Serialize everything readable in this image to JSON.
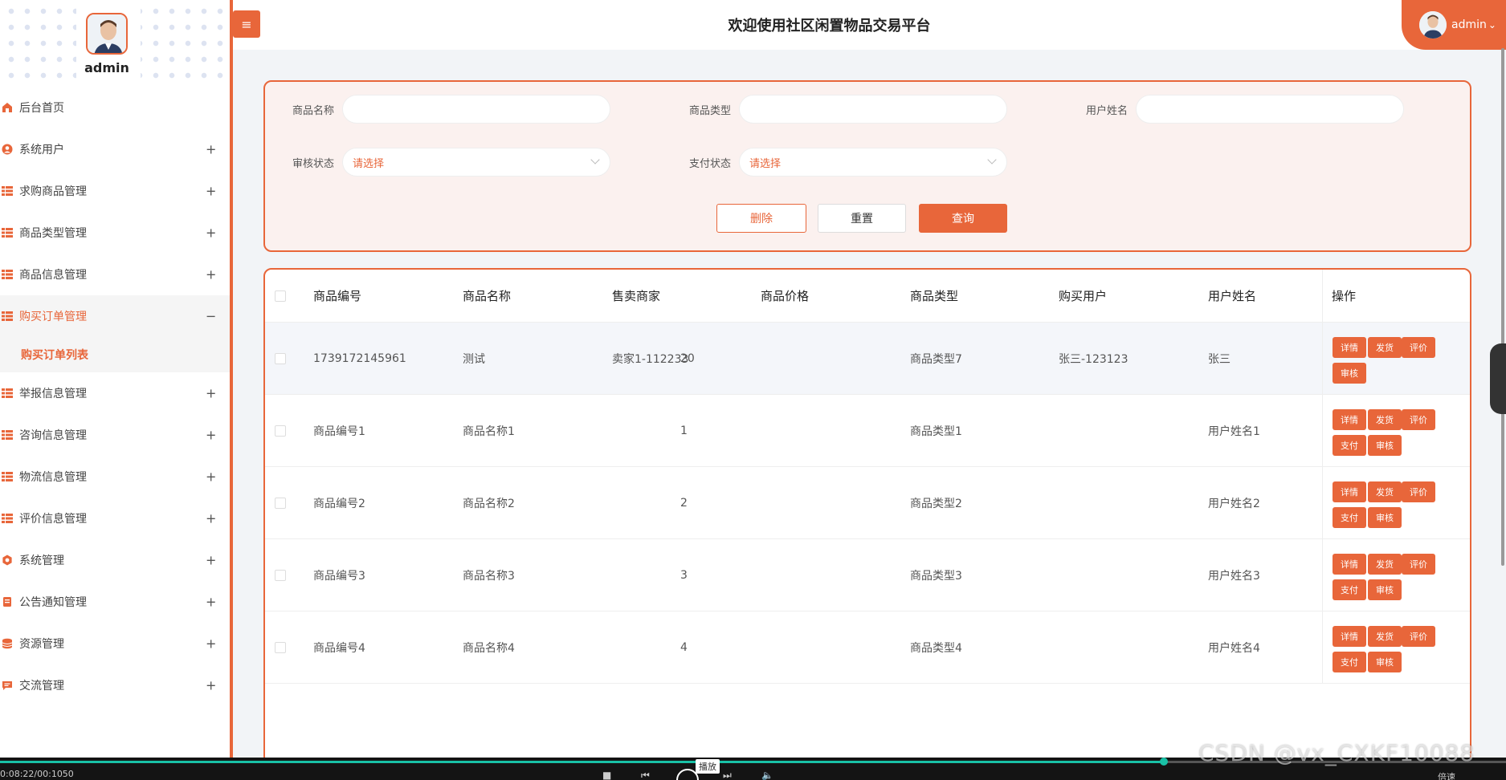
{
  "sidebar": {
    "username": "admin",
    "items": [
      {
        "label": "后台首页",
        "icon": "home-icon",
        "expandable": false
      },
      {
        "label": "系统用户",
        "icon": "user-icon",
        "expandable": true
      },
      {
        "label": "求购商品管理",
        "icon": "grid-icon",
        "expandable": true
      },
      {
        "label": "商品类型管理",
        "icon": "grid-icon",
        "expandable": true
      },
      {
        "label": "商品信息管理",
        "icon": "grid-icon",
        "expandable": true
      },
      {
        "label": "购买订单管理",
        "icon": "grid-icon",
        "expandable": true,
        "active": true,
        "toggle": "−"
      },
      {
        "label": "举报信息管理",
        "icon": "grid-icon",
        "expandable": true
      },
      {
        "label": "咨询信息管理",
        "icon": "grid-icon",
        "expandable": true
      },
      {
        "label": "物流信息管理",
        "icon": "grid-icon",
        "expandable": true
      },
      {
        "label": "评价信息管理",
        "icon": "grid-icon",
        "expandable": true
      },
      {
        "label": "系统管理",
        "icon": "gear-icon",
        "expandable": true
      },
      {
        "label": "公告通知管理",
        "icon": "notice-icon",
        "expandable": true
      },
      {
        "label": "资源管理",
        "icon": "database-icon",
        "expandable": true
      },
      {
        "label": "交流管理",
        "icon": "chat-icon",
        "expandable": true
      }
    ],
    "submenu_label": "购买订单列表",
    "plus": "+"
  },
  "header": {
    "title": "欢迎使用社区闲置物品交易平台",
    "toggle_icon": "≡",
    "user_label": "admin",
    "user_caret": "⌄"
  },
  "search": {
    "fields": [
      {
        "label": "商品名称",
        "value": ""
      },
      {
        "label": "商品类型",
        "value": ""
      },
      {
        "label": "用户姓名",
        "value": ""
      },
      {
        "label": "审核状态",
        "value": "请选择"
      },
      {
        "label": "支付状态",
        "value": "请选择"
      }
    ],
    "buttons": {
      "delete": "删除",
      "reset": "重置",
      "query": "查询"
    }
  },
  "table": {
    "columns": [
      "商品编号",
      "商品名称",
      "售卖商家",
      "商品价格",
      "商品类型",
      "购买用户",
      "用户姓名",
      "操作"
    ],
    "rows": [
      {
        "id": "1739172145961",
        "name": "测试",
        "seller": "卖家1-112233",
        "price": "20",
        "type": "商品类型7",
        "buyer": "张三-123123",
        "user": "张三",
        "ops": [
          "详情",
          "发货",
          "评价",
          "审核"
        ]
      },
      {
        "id": "商品编号1",
        "name": "商品名称1",
        "seller": "",
        "price": "1",
        "type": "商品类型1",
        "buyer": "",
        "user": "用户姓名1",
        "ops": [
          "详情",
          "发货",
          "评价",
          "支付",
          "审核"
        ]
      },
      {
        "id": "商品编号2",
        "name": "商品名称2",
        "seller": "",
        "price": "2",
        "type": "商品类型2",
        "buyer": "",
        "user": "用户姓名2",
        "ops": [
          "详情",
          "发货",
          "评价",
          "支付",
          "审核"
        ]
      },
      {
        "id": "商品编号3",
        "name": "商品名称3",
        "seller": "",
        "price": "3",
        "type": "商品类型3",
        "buyer": "",
        "user": "用户姓名3",
        "ops": [
          "详情",
          "发货",
          "评价",
          "支付",
          "审核"
        ]
      },
      {
        "id": "商品编号4",
        "name": "商品名称4",
        "seller": "",
        "price": "4",
        "type": "商品类型4",
        "buyer": "",
        "user": "用户姓名4",
        "ops": [
          "详情",
          "发货",
          "评价",
          "支付",
          "审核"
        ]
      }
    ]
  },
  "player": {
    "time": "0:08:22/00:1050",
    "play_tip": "播放",
    "speed": "倍速",
    "progress": 0.773,
    "watermark": "CSDN @vx_CXKF10088"
  },
  "colors": {
    "accent": "#e8663a",
    "panel_bg": "#fbf1ef",
    "progress": "#19c1a6"
  }
}
